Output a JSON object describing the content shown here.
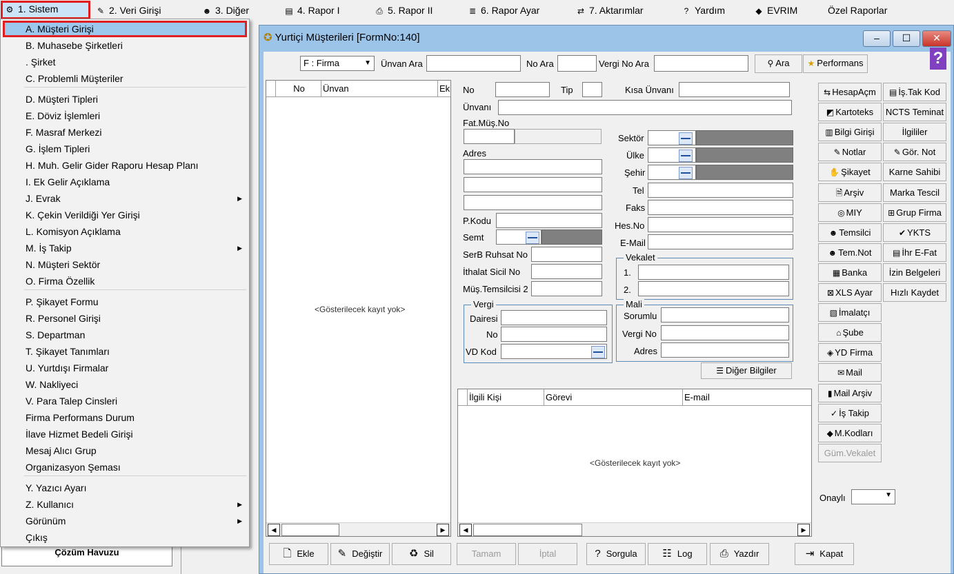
{
  "menubar": {
    "items": [
      {
        "label": "1.  Sistem",
        "icon": "gear-icon"
      },
      {
        "label": "2.   Veri Girişi",
        "icon": "edit-icon"
      },
      {
        "label": "3.  Diğer",
        "icon": "people-icon"
      },
      {
        "label": "4.   Rapor I",
        "icon": "report-icon"
      },
      {
        "label": "5.   Rapor II",
        "icon": "printer-icon"
      },
      {
        "label": "6.   Rapor Ayar",
        "icon": "stack-icon"
      },
      {
        "label": "7.   Aktarımlar",
        "icon": "transfer-icon"
      },
      {
        "label": "Yardım",
        "icon": "help-icon"
      },
      {
        "label": "EVRIM",
        "icon": "book-icon"
      },
      {
        "label": "Özel Raporlar",
        "icon": ""
      }
    ]
  },
  "dropdown": {
    "items": [
      {
        "label": "A.   Müşteri Girişi",
        "selected": true
      },
      {
        "label": "B.   Muhasebe Şirketleri"
      },
      {
        "label": ".   Şirket"
      },
      {
        "label": "C.   Problemli Müşteriler"
      },
      {
        "label": "D.   Müşteri Tipleri"
      },
      {
        "label": "E.   Döviz İşlemleri"
      },
      {
        "label": "F.   Masraf Merkezi"
      },
      {
        "label": "G.   İşlem Tipleri"
      },
      {
        "label": "H.   Muh. Gelir Gider Raporu Hesap Planı"
      },
      {
        "label": "I.   Ek Gelir Açıklama"
      },
      {
        "label": "J.   Evrak",
        "submenu": true
      },
      {
        "label": "K.   Çekin Verildiği Yer Girişi"
      },
      {
        "label": "L.   Komisyon Açıklama"
      },
      {
        "label": "M.   İş Takip",
        "submenu": true
      },
      {
        "label": "N.   Müşteri Sektör"
      },
      {
        "label": "O.  Firma Özellik"
      },
      {
        "label": "P.   Şikayet Formu"
      },
      {
        "label": "R.   Personel Girişi"
      },
      {
        "label": "S.   Departman"
      },
      {
        "label": "T.   Şikayet Tanımları"
      },
      {
        "label": "U.   Yurtdışı Firmalar"
      },
      {
        "label": "W.   Nakliyeci"
      },
      {
        "label": "V.  Para Talep Cinsleri"
      },
      {
        "label": "Firma Performans Durum"
      },
      {
        "label": "İlave Hizmet Bedeli Girişi"
      },
      {
        "label": "Mesaj Alıcı Grup"
      },
      {
        "label": "Organizasyon Şeması"
      },
      {
        "label": "Y.   Yazıcı Ayarı"
      },
      {
        "label": "Z.   Kullanıcı",
        "submenu": true
      },
      {
        "label": "Görünüm",
        "submenu": true
      },
      {
        "label": "Çıkış"
      }
    ]
  },
  "left_panel": {
    "cozum_label": "Çözüm Havuzu"
  },
  "window": {
    "title": "Yurtiçi Müşterileri [FormNo:140]",
    "minimize": "‒",
    "maximize": "☐",
    "close": "✕",
    "help": "?"
  },
  "search": {
    "type_value": "F : Firma",
    "unvan_label": "Ünvan Ara",
    "no_label": "No Ara",
    "vergi_label": "Vergi No Ara",
    "ara_button": "Ara",
    "performans_button": "Performans"
  },
  "left_grid": {
    "columns": [
      "No",
      "Ünvan",
      "Ek"
    ],
    "empty_text": "<Gösterilecek kayıt yok>"
  },
  "form": {
    "no": "No",
    "tip": "Tip",
    "kisa_unvan": "Kısa Ünvanı",
    "unvan": "Ünvanı",
    "fat_mus_no": "Fat.Müş.No",
    "adres": "Adres",
    "pkodu": "P.Kodu",
    "semt": "Semt",
    "serb_ruhsat": "SerB Ruhsat No",
    "ithalat_sicil": "İthalat Sicil No",
    "mus_temsilcisi": "Müş.Temsilcisi 2",
    "sektor": "Sektör",
    "ulke": "Ülke",
    "sehir": "Şehir",
    "tel": "Tel",
    "faks": "Faks",
    "hes_no": "Hes.No",
    "email": "E-Mail",
    "vekalet_title": "Vekalet",
    "vekalet_1": "1.",
    "vekalet_2": "2.",
    "vergi_title": "Vergi",
    "vergi_dairesi": "Dairesi",
    "vergi_no": "No",
    "vd_kod": "VD Kod",
    "mali_title": "Mali",
    "mali_sorumlu": "Sorumlu",
    "mali_vergi_no": "Vergi No",
    "mali_adres": "Adres",
    "diger_bilgiler": "Diğer Bilgiler"
  },
  "contact_grid": {
    "columns": [
      "İlgili Kişi",
      "Görevi",
      "E-mail"
    ],
    "empty_text": "<Gösterilecek kayıt yok>"
  },
  "right_col1": [
    {
      "label": "HesapAçm",
      "icon": "account-icon"
    },
    {
      "label": "Kartoteks",
      "icon": "card-icon"
    },
    {
      "label": "Bilgi Girişi",
      "icon": "info-icon"
    },
    {
      "label": "Notlar",
      "icon": "notes-icon"
    },
    {
      "label": "Şikayet",
      "icon": "complaint-icon"
    },
    {
      "label": "Arşiv",
      "icon": "archive-icon"
    },
    {
      "label": "MIY",
      "icon": "globe-icon"
    },
    {
      "label": "Temsilci",
      "icon": "agent-icon"
    },
    {
      "label": "Tem.Not",
      "icon": "agent-note-icon"
    },
    {
      "label": "Banka",
      "icon": "bank-icon"
    },
    {
      "label": "XLS Ayar",
      "icon": "excel-icon"
    },
    {
      "label": "İmalatçı",
      "icon": "factory-icon"
    },
    {
      "label": "Şube",
      "icon": "branch-icon"
    },
    {
      "label": "YD Firma",
      "icon": "foreign-firm-icon"
    },
    {
      "label": "Mail",
      "icon": "mail-icon"
    },
    {
      "label": "Mail Arşiv",
      "icon": "mail-archive-icon"
    },
    {
      "label": "İş Takip",
      "icon": "task-icon"
    },
    {
      "label": "M.Kodları",
      "icon": "codes-icon"
    },
    {
      "label": "Güm.Vekalet",
      "icon": "",
      "disabled": true
    }
  ],
  "right_col2": [
    {
      "label": "İş.Tak Kod",
      "icon": "task-code-icon"
    },
    {
      "label": "NCTS Teminat",
      "icon": ""
    },
    {
      "label": "İlgililer",
      "icon": ""
    },
    {
      "label": "Gör. Not",
      "icon": "view-note-icon"
    },
    {
      "label": "Karne Sahibi",
      "icon": ""
    },
    {
      "label": "Marka Tescil",
      "icon": ""
    },
    {
      "label": "Grup Firma",
      "icon": "group-icon"
    },
    {
      "label": "YKTS",
      "icon": "check-icon"
    },
    {
      "label": "İhr E-Fat",
      "icon": "invoice-icon"
    },
    {
      "label": "İzin Belgeleri",
      "icon": ""
    },
    {
      "label": "Hızlı Kaydet",
      "icon": ""
    }
  ],
  "onayli_label": "Onaylı",
  "bottom_buttons": [
    {
      "label": "Ekle",
      "icon": "add-icon"
    },
    {
      "label": "Değiştir",
      "icon": "edit-icon"
    },
    {
      "label": "Sil",
      "icon": "delete-icon"
    },
    {
      "label": "Tamam",
      "icon": "",
      "disabled": true
    },
    {
      "label": "İptal",
      "icon": "",
      "disabled": true
    },
    {
      "label": "Sorgula",
      "icon": "query-icon"
    },
    {
      "label": "Log",
      "icon": "log-icon"
    },
    {
      "label": "Yazdır",
      "icon": "printer-icon"
    },
    {
      "label": "Kapat",
      "icon": "exit-icon"
    }
  ]
}
